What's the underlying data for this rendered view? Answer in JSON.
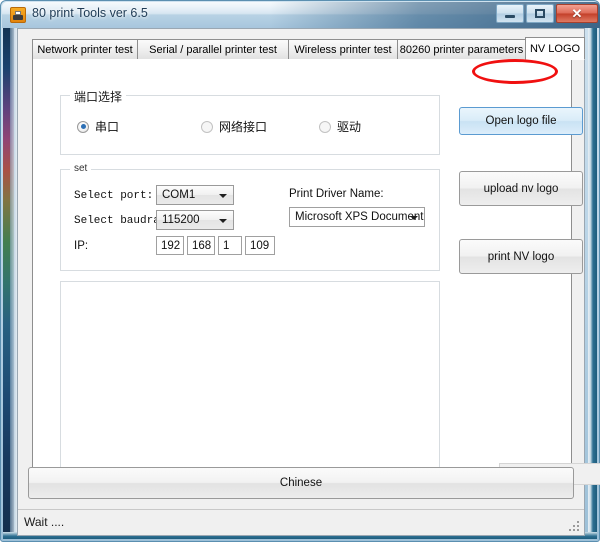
{
  "window": {
    "title": "80 print Tools ver 6.5",
    "icon": "printer-icon",
    "minimize_label": "",
    "maximize_label": "",
    "close_label": "✕"
  },
  "tabs": [
    {
      "label": "Network printer test",
      "active": false
    },
    {
      "label": "Serial / parallel printer test",
      "active": false
    },
    {
      "label": "Wireless printer test",
      "active": false
    },
    {
      "label": "80260 printer parameters",
      "active": false
    },
    {
      "label": "NV LOGO",
      "active": true
    }
  ],
  "annotation": {
    "type": "ellipse-highlight",
    "color": "#f01010",
    "target_tab": "NV LOGO"
  },
  "port_group": {
    "title": "端口选择",
    "options": [
      {
        "label": "串口",
        "selected": true
      },
      {
        "label": "网络接口",
        "selected": false
      },
      {
        "label": "驱动",
        "selected": false
      }
    ]
  },
  "set_group": {
    "title": "set",
    "select_port_label": "Select port:",
    "select_port_value": "COM1",
    "select_baudrate_label": "Select baudrat",
    "select_baudrate_value": "115200",
    "ip_label": "IP:",
    "ip": [
      "192",
      "168",
      "1",
      "109"
    ],
    "print_driver_label": "Print Driver Name:",
    "print_driver_value": "Microsoft XPS Document"
  },
  "actions": {
    "open_logo_file": "Open logo file",
    "upload_nv_logo": "upload nv logo",
    "print_nv_logo": "print NV logo",
    "language_toggle": "Chinese"
  },
  "status": {
    "text": "Wait ...."
  },
  "colors": {
    "accent": "#2c6fb5",
    "annotation_red": "#f01010",
    "title_bar": "#cde0ee",
    "close_button": "#c33f29",
    "client_bg": "#f0f0f0"
  }
}
